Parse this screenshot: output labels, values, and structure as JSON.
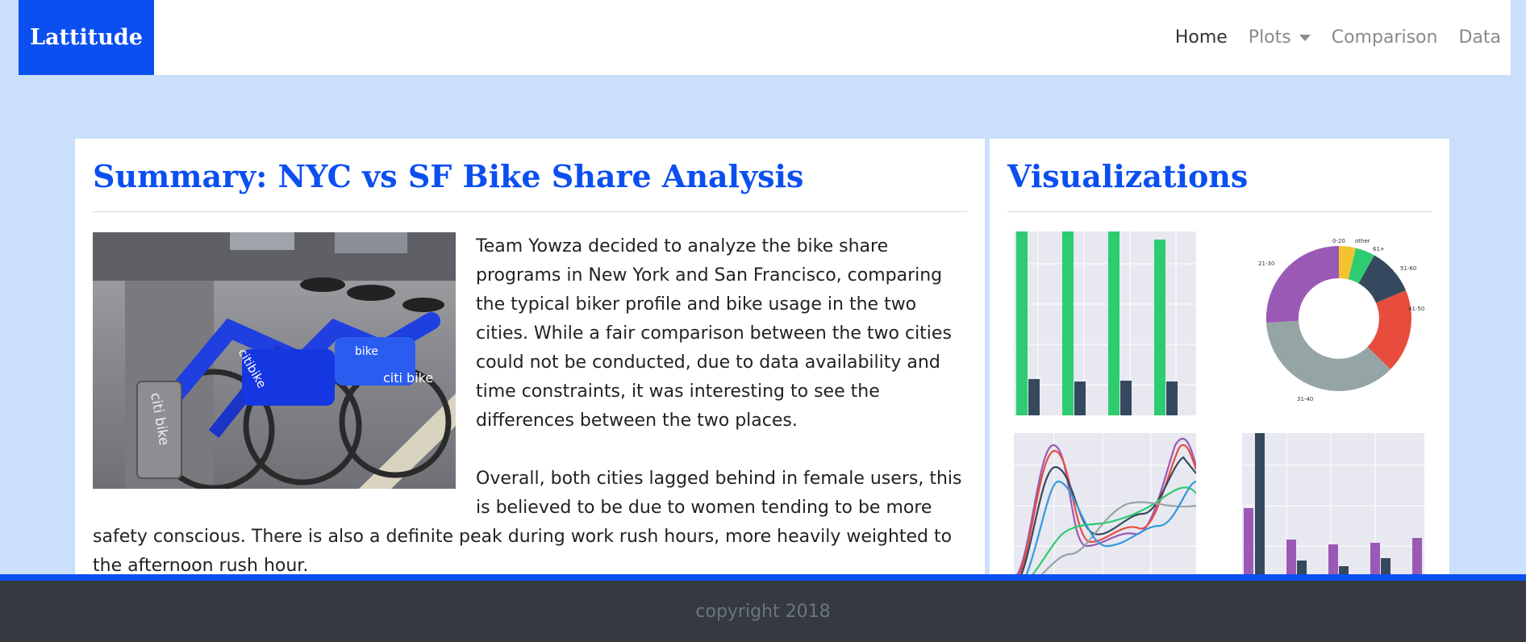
{
  "brand": "Lattitude",
  "nav": {
    "home": "Home",
    "plots": "Plots",
    "comparison": "Comparison",
    "data": "Data"
  },
  "summary": {
    "title": "Summary: NYC vs SF Bike Share Analysis",
    "paragraph1": "Team Yowza decided to analyze the bike share programs in New York and San Francisco, comparing the typical biker profile and bike usage in the two cities. While a fair comparison between the two cities could not be conducted, due to data availability and time constraints, it was interesting to see the differences between the two places.",
    "paragraph2": "Overall, both cities lagged behind in female users, this is believed to be due to women tending to be more safety conscious. There is also a definite peak during work rush hours, more heavily weighted to the afternoon rush hour.",
    "photo_text": [
      "citi bike",
      "citibike",
      "citi bike",
      "bike"
    ]
  },
  "visualizations": {
    "title": "Visualizations",
    "pie_labels": [
      "0-20",
      "other",
      "61+",
      "51-60",
      "41-50",
      "31-40",
      "21-30"
    ]
  },
  "colors": {
    "accent": "#0b4ff0",
    "background": "#cadff9",
    "footer": "#343a40"
  },
  "footer": {
    "copyright": "copyright 2018"
  }
}
